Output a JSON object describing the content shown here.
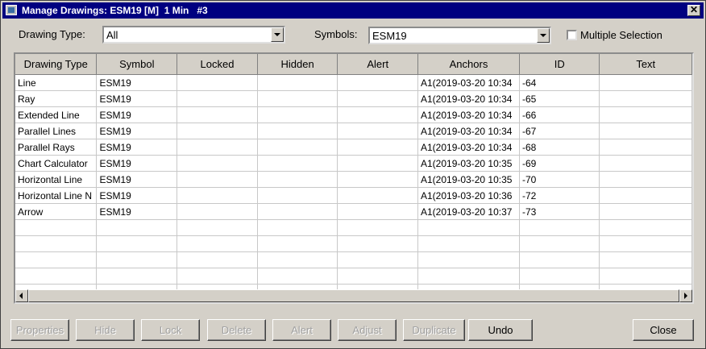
{
  "window": {
    "title": "Manage Drawings: ESM19 [M]  1 Min   #3",
    "close_glyph": "✕"
  },
  "filters": {
    "drawing_type_label": "Drawing Type:",
    "drawing_type_value": "All",
    "symbols_label": "Symbols:",
    "symbols_value": "ESM19",
    "multiple_selection_label": "Multiple Selection",
    "multiple_selection_checked": false
  },
  "table": {
    "columns": [
      "Drawing Type",
      "Symbol",
      "Locked",
      "Hidden",
      "Alert",
      "Anchors",
      "ID",
      "Text"
    ],
    "rows": [
      [
        "Line",
        "ESM19",
        "",
        "",
        "",
        "A1(2019-03-20  10:34",
        "-64",
        ""
      ],
      [
        "Ray",
        "ESM19",
        "",
        "",
        "",
        "A1(2019-03-20  10:34",
        "-65",
        ""
      ],
      [
        "Extended Line",
        "ESM19",
        "",
        "",
        "",
        "A1(2019-03-20  10:34",
        "-66",
        ""
      ],
      [
        "Parallel Lines",
        "ESM19",
        "",
        "",
        "",
        "A1(2019-03-20  10:34",
        "-67",
        ""
      ],
      [
        "Parallel Rays",
        "ESM19",
        "",
        "",
        "",
        "A1(2019-03-20  10:34",
        "-68",
        ""
      ],
      [
        "Chart Calculator",
        "ESM19",
        "",
        "",
        "",
        "A1(2019-03-20  10:35",
        "-69",
        ""
      ],
      [
        "Horizontal Line",
        "ESM19",
        "",
        "",
        "",
        "A1(2019-03-20  10:35",
        "-70",
        ""
      ],
      [
        "Horizontal Line N",
        "ESM19",
        "",
        "",
        "",
        "A1(2019-03-20  10:36",
        "-72",
        ""
      ],
      [
        "Arrow",
        "ESM19",
        "",
        "",
        "",
        "A1(2019-03-20  10:37",
        "-73",
        ""
      ]
    ],
    "empty_rows": 5
  },
  "buttons": [
    {
      "key": "properties",
      "label": "Properties",
      "enabled": false
    },
    {
      "key": "hide",
      "label": "Hide",
      "enabled": false
    },
    {
      "key": "lock",
      "label": "Lock",
      "enabled": false
    },
    {
      "key": "delete",
      "label": "Delete",
      "enabled": false
    },
    {
      "key": "alert",
      "label": "Alert",
      "enabled": false
    },
    {
      "key": "adjust",
      "label": "Adjust",
      "enabled": false
    },
    {
      "key": "duplicate",
      "label": "Duplicate",
      "enabled": false
    },
    {
      "key": "undo",
      "label": "Undo",
      "enabled": true
    },
    {
      "key": "close",
      "label": "Close",
      "enabled": true
    }
  ]
}
